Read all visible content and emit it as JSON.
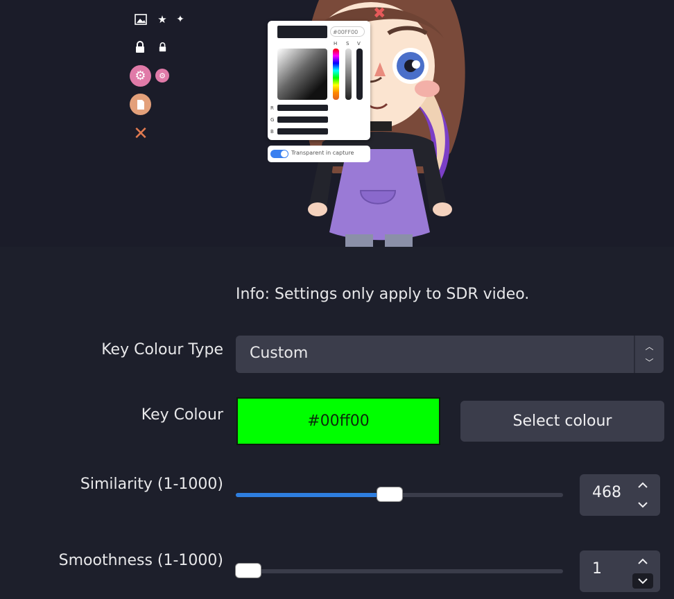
{
  "preview": {
    "icons": [
      "image-icon",
      "sparkle-icon",
      "lock-icon",
      "lock-small-icon",
      "gear-icon",
      "gear-small-icon",
      "file-icon",
      "close-icon"
    ],
    "picker": {
      "hex_value": "#00FF00",
      "h_label": "H",
      "s_label": "S",
      "v_label": "V",
      "r_label": "R",
      "g_label": "G",
      "b_label": "B",
      "toggle_label": "Transparent in capture",
      "toggle_on": true
    }
  },
  "info": "Info: Settings only apply to SDR video.",
  "key_colour_type": {
    "label": "Key Colour Type",
    "value": "Custom"
  },
  "key_colour": {
    "label": "Key Colour",
    "value": "#00ff00",
    "button": "Select colour",
    "swatch": "#00ff00"
  },
  "similarity": {
    "label": "Similarity (1-1000)",
    "value": "468",
    "fraction": 0.468
  },
  "smoothness": {
    "label": "Smoothness (1-1000)",
    "value": "1",
    "fraction": 0.001
  },
  "colors": {
    "accent": "#2e7ee0",
    "panel": "#1d1f2b",
    "control": "#3b3d4b"
  }
}
